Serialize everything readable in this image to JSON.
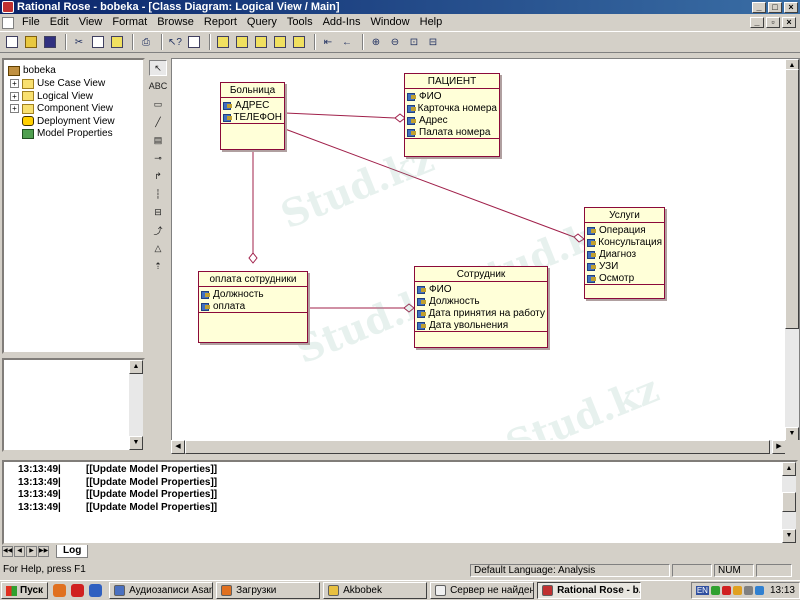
{
  "window": {
    "title": "Rational Rose - bobeka - [Class Diagram: Logical View / Main]"
  },
  "menu": [
    {
      "label": "File",
      "enabled": true
    },
    {
      "label": "Edit",
      "enabled": true
    },
    {
      "label": "View",
      "enabled": true
    },
    {
      "label": "Format",
      "enabled": true
    },
    {
      "label": "Browse",
      "enabled": true
    },
    {
      "label": "Report",
      "enabled": true
    },
    {
      "label": "Query",
      "enabled": true
    },
    {
      "label": "Tools",
      "enabled": true
    },
    {
      "label": "Add-Ins",
      "enabled": true
    },
    {
      "label": "Window",
      "enabled": true
    },
    {
      "label": "Help",
      "enabled": true
    }
  ],
  "browser": {
    "root": "bobeka",
    "items": [
      {
        "label": "Use Case View",
        "icon": "folder-icon",
        "expandable": true
      },
      {
        "label": "Logical View",
        "icon": "folder-icon",
        "expandable": true
      },
      {
        "label": "Component View",
        "icon": "folder-icon",
        "expandable": true
      },
      {
        "label": "Deployment View",
        "icon": "deployment-icon",
        "expandable": false
      },
      {
        "label": "Model Properties",
        "icon": "model-properties-icon",
        "expandable": false
      }
    ]
  },
  "toolbox": {
    "text_tool_label": "ABC"
  },
  "diagram": {
    "classes": {
      "hospital": {
        "name": "Больница",
        "attributes": [
          "АДРЕС",
          "ТЕЛЕФОН"
        ]
      },
      "patient": {
        "name": "ПАЦИЕНТ",
        "attributes": [
          "ФИО",
          "Карточка номера",
          "Адрес",
          "Палата номера"
        ]
      },
      "services": {
        "name": "Услуги",
        "attributes": [
          "Операция",
          "Консультация",
          "Диагноз",
          "УЗИ",
          "Осмотр"
        ]
      },
      "staff_payment": {
        "name": "оплата сотрудники",
        "attributes": [
          "Должность",
          "оплата"
        ]
      },
      "employee": {
        "name": "Сотрудник",
        "attributes": [
          "ФИО",
          "Должность",
          "Дата принятия на работу",
          "Дата увольнения"
        ]
      }
    },
    "watermark": "Stud.kz"
  },
  "log": {
    "entries": [
      {
        "time": "13:13:49|",
        "message": "[[Update Model Properties]]"
      },
      {
        "time": "13:13:49|",
        "message": "[[Update Model Properties]]"
      },
      {
        "time": "13:13:49|",
        "message": "[[Update Model Properties]]"
      },
      {
        "time": "13:13:49|",
        "message": "[[Update Model Properties]]"
      }
    ],
    "tab_label": "Log"
  },
  "statusbar": {
    "help": "For Help, press F1",
    "language": "Default Language: Analysis",
    "num": "NUM"
  },
  "taskbar": {
    "start_label": "Пуск",
    "tasks": [
      {
        "label": "Аудиозаписи Asan...",
        "active": false,
        "color": "#4a70c0"
      },
      {
        "label": "Загрузки",
        "active": false,
        "color": "#e07020"
      },
      {
        "label": "Akbobek",
        "active": false,
        "color": "#e8c040"
      },
      {
        "label": "Сервер не найден...",
        "active": false,
        "color": "#f0f0f0"
      },
      {
        "label": "Rational Rose - b...",
        "active": true,
        "color": "#c03030"
      }
    ],
    "tray_lang": "EN",
    "clock": "13:13"
  },
  "colors": {
    "class_fill": "#ffffd8",
    "class_border": "#8b0a3a",
    "relation_line": "#a0204a",
    "titlebar": "#0a246a"
  }
}
